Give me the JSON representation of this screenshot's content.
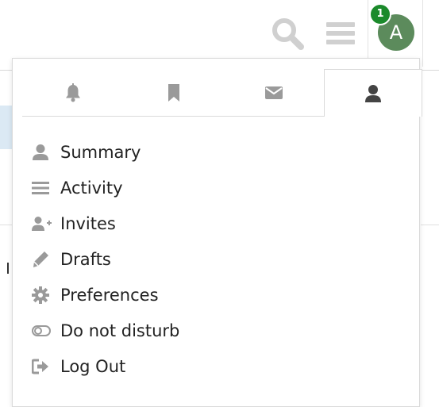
{
  "header": {
    "notification_count": "1",
    "avatar_letter": "A"
  },
  "user_menu": {
    "tabs": [
      {
        "icon": "bell-icon",
        "active": false
      },
      {
        "icon": "bookmark-icon",
        "active": false
      },
      {
        "icon": "envelope-icon",
        "active": false
      },
      {
        "icon": "user-icon",
        "active": true
      }
    ],
    "items": [
      {
        "icon": "user-icon",
        "label": "Summary"
      },
      {
        "icon": "list-icon",
        "label": "Activity"
      },
      {
        "icon": "user-plus-icon",
        "label": "Invites"
      },
      {
        "icon": "pencil-icon",
        "label": "Drafts"
      },
      {
        "icon": "gear-icon",
        "label": "Preferences"
      },
      {
        "icon": "toggle-off-icon",
        "label": "Do not disturb"
      },
      {
        "icon": "sign-out-icon",
        "label": "Log Out"
      }
    ]
  },
  "colors": {
    "avatar_bg": "#5c8b5c",
    "badge_bg": "#1b8a2b",
    "icon_gray": "#9a9a9a",
    "text": "#222222"
  }
}
